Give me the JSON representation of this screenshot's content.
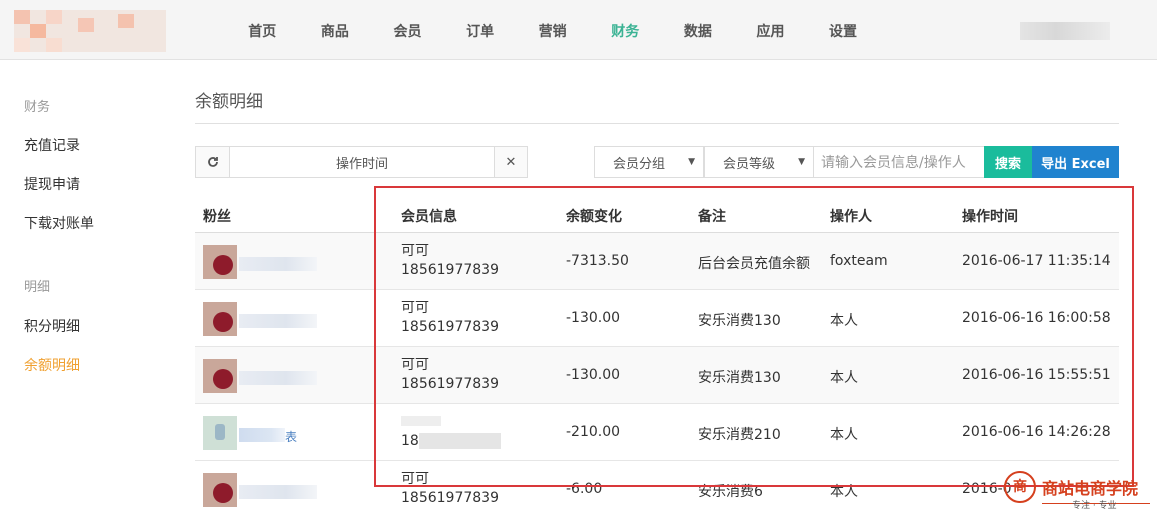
{
  "nav": {
    "items": [
      "首页",
      "商品",
      "会员",
      "订单",
      "营销",
      "财务",
      "数据",
      "应用",
      "设置"
    ],
    "active_index": 5
  },
  "sidebar": {
    "group1": "财务",
    "items1": [
      "充值记录",
      "提现申请",
      "下载对账单"
    ],
    "group2": "明细",
    "items2": [
      "积分明细",
      "余额明细"
    ]
  },
  "page": {
    "title": "余额明细"
  },
  "toolbar": {
    "refresh_icon": "refresh-icon",
    "time_label": "操作时间",
    "clear_icon": "close-icon",
    "group_select": "会员分组",
    "level_select": "会员等级",
    "search_placeholder": "请输入会员信息/操作人",
    "search_button": "搜索",
    "export_button": "导出 Excel"
  },
  "table": {
    "headers": [
      "粉丝",
      "会员信息",
      "余额变化",
      "备注",
      "操作人",
      "操作时间"
    ],
    "rows": [
      {
        "name": "可可",
        "phone": "18561977839",
        "balance": "-7313.50",
        "note": "后台会员充值余额",
        "operator": "foxteam",
        "time": "2016-06-17 11:35:14"
      },
      {
        "name": "可可",
        "phone": "18561977839",
        "balance": "-130.00",
        "note": "安乐消费130",
        "operator": "本人",
        "time": "2016-06-16 16:00:58"
      },
      {
        "name": "可可",
        "phone": "18561977839",
        "balance": "-130.00",
        "note": "安乐消费130",
        "operator": "本人",
        "time": "2016-06-16 15:55:51"
      },
      {
        "name": "",
        "phone": "18",
        "balance": "-210.00",
        "note": "安乐消费210",
        "operator": "本人",
        "time": "2016-06-16 14:26:28",
        "fan_suffix": "表"
      },
      {
        "name": "可可",
        "phone": "18561977839",
        "balance": "-6.00",
        "note": "安乐消费6",
        "operator": "本人",
        "time": "2016-0"
      }
    ]
  },
  "watermark": {
    "text": "商站电商学院",
    "sub": "专注 · 专业"
  },
  "colors": {
    "accent": "#3bb394",
    "sidebar_active": "#f0a030",
    "search": "#1abc9c",
    "export": "#2083cf",
    "highlight": "#d9383a"
  }
}
